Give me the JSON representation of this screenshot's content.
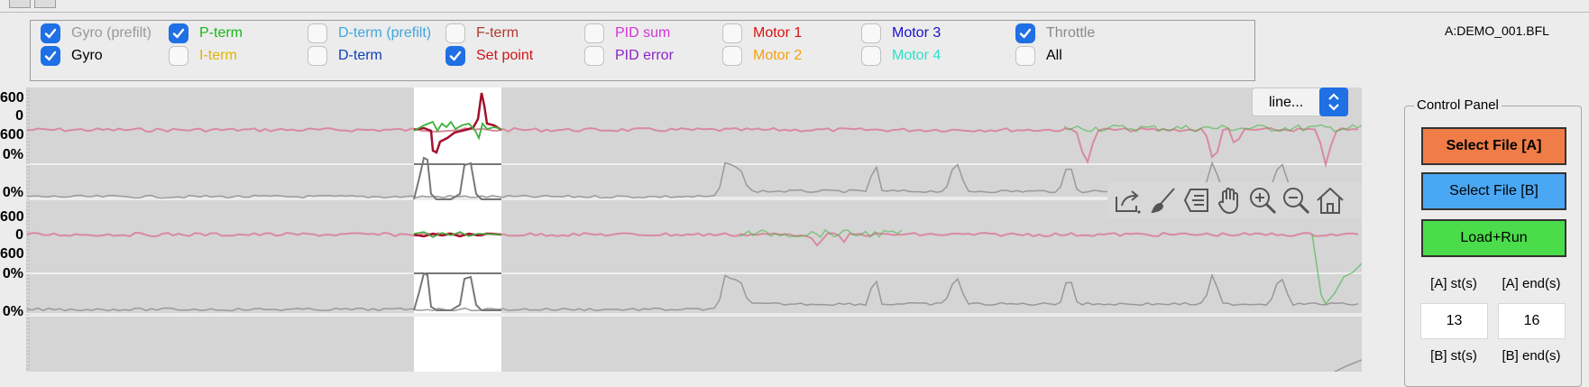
{
  "legend": [
    {
      "label": "Gyro (prefilt)",
      "checked": true,
      "color": "#999999"
    },
    {
      "label": "Gyro",
      "checked": true,
      "color": "#000000"
    },
    {
      "label": "P-term",
      "checked": true,
      "color": "#17b817"
    },
    {
      "label": "I-term",
      "checked": false,
      "color": "#e0b400"
    },
    {
      "label": "D-term (prefilt)",
      "checked": false,
      "color": "#41a6dc"
    },
    {
      "label": "D-term",
      "checked": false,
      "color": "#1040b5"
    },
    {
      "label": "F-term",
      "checked": false,
      "color": "#b03a2e"
    },
    {
      "label": "Set point",
      "checked": true,
      "color": "#d21417"
    },
    {
      "label": "PID sum",
      "checked": false,
      "color": "#d336d8"
    },
    {
      "label": "PID error",
      "checked": false,
      "color": "#8b24c6"
    },
    {
      "label": "Motor 1",
      "checked": false,
      "color": "#e01010"
    },
    {
      "label": "Motor 2",
      "checked": false,
      "color": "#f5a10a"
    },
    {
      "label": "Motor 3",
      "checked": false,
      "color": "#1a10c8"
    },
    {
      "label": "Motor 4",
      "checked": false,
      "color": "#2ee0c9"
    },
    {
      "label": "Throttle",
      "checked": true,
      "color": "#8a8a8a"
    },
    {
      "label": "All",
      "checked": false,
      "color": "#000000"
    }
  ],
  "filename": "A:DEMO_001.BFL",
  "plots": {
    "axis_labels_top": [
      "600",
      "0",
      "600"
    ],
    "axis_labels_pct": [
      "0%",
      "0%"
    ],
    "axis_labels_bottom": [
      "600",
      "0",
      "600"
    ]
  },
  "dropdown": {
    "value": "line..."
  },
  "toolbar": {
    "icons": [
      "export-icon",
      "brush-icon",
      "subplot-config-icon",
      "pan-icon",
      "zoom-in-icon",
      "zoom-out-icon",
      "home-icon"
    ]
  },
  "control_panel": {
    "title": "Control Panel",
    "select_a": "Select File [A]",
    "select_b": "Select File [B]",
    "load_run": "Load+Run",
    "a_start_label": "[A] st(s)",
    "a_end_label": "[A] end(s)",
    "a_start": "13",
    "a_end": "16",
    "b_start_label": "[B] st(s)",
    "b_end_label": "[B] end(s)"
  },
  "colors": {
    "gyro": "#d98aa0",
    "setpoint": "#a3102c",
    "pterm": "#3cb33c",
    "throttle": "#777777",
    "selectA": "#f07c48",
    "selectB": "#4aa7f4",
    "loadRun": "#4bdc4b"
  }
}
